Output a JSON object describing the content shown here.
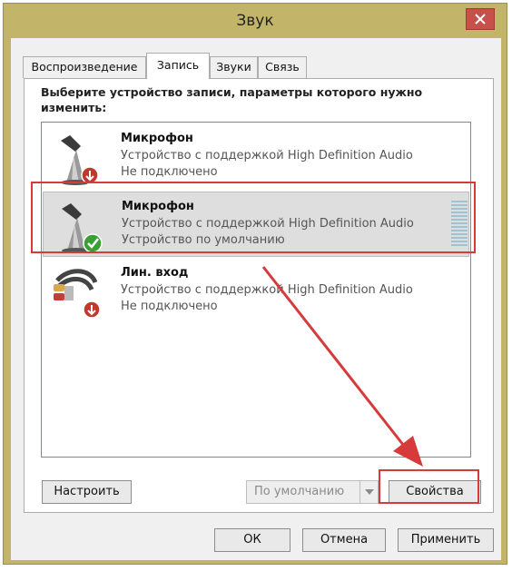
{
  "window": {
    "title": "Звук"
  },
  "tabs": [
    {
      "label": "Воспроизведение",
      "active": false
    },
    {
      "label": "Запись",
      "active": true
    },
    {
      "label": "Звуки",
      "active": false
    },
    {
      "label": "Связь",
      "active": false
    }
  ],
  "instruction": "Выберите устройство записи, параметры которого нужно изменить:",
  "devices": [
    {
      "name": "Микрофон",
      "description": "Устройство с поддержкой High Definition Audio",
      "status": "Не подключено",
      "icon": "microphone-icon",
      "badge": "disconnected-badge-icon",
      "selected": false
    },
    {
      "name": "Микрофон",
      "description": "Устройство с поддержкой High Definition Audio",
      "status": "Устройство по умолчанию",
      "icon": "microphone-icon",
      "badge": "default-check-badge-icon",
      "selected": true
    },
    {
      "name": "Лин. вход",
      "description": "Устройство с поддержкой High Definition Audio",
      "status": "Не подключено",
      "icon": "line-in-cable-icon",
      "badge": "disconnected-badge-icon",
      "selected": false
    }
  ],
  "buttons": {
    "configure": "Настроить",
    "set_default": "По умолчанию",
    "properties": "Свойства",
    "ok": "ОК",
    "cancel": "Отмена",
    "apply": "Применить"
  },
  "colors": {
    "title_bar": "#c2b56a",
    "close_button": "#c7504a",
    "annotation_red": "#d63a3a",
    "check_green": "#3aa033",
    "disconnect_red": "#c0392b"
  }
}
